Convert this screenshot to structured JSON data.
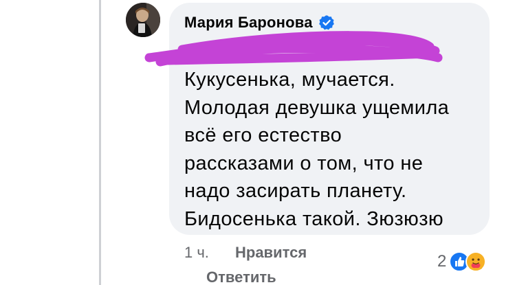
{
  "comment": {
    "author": "Мария Баронова",
    "verified": true,
    "text_lines": [
      "Кукусенька, мучается.",
      "Молодая девушка ущемила",
      "всё его естество",
      "рассказами о том, что не",
      "надо засирать планету.",
      "Бидосенька такой. Зюзюзю"
    ],
    "time": "1 ч.",
    "like_label": "Нравится",
    "reply_label": "Ответить",
    "reaction_count": "2",
    "reactions": [
      "like-icon",
      "care-icon"
    ]
  },
  "colors": {
    "bubble_bg": "#f0f2f5",
    "verified_blue": "#1877f2",
    "scribble_magenta": "#c23bd4",
    "meta_gray": "#65676b"
  }
}
